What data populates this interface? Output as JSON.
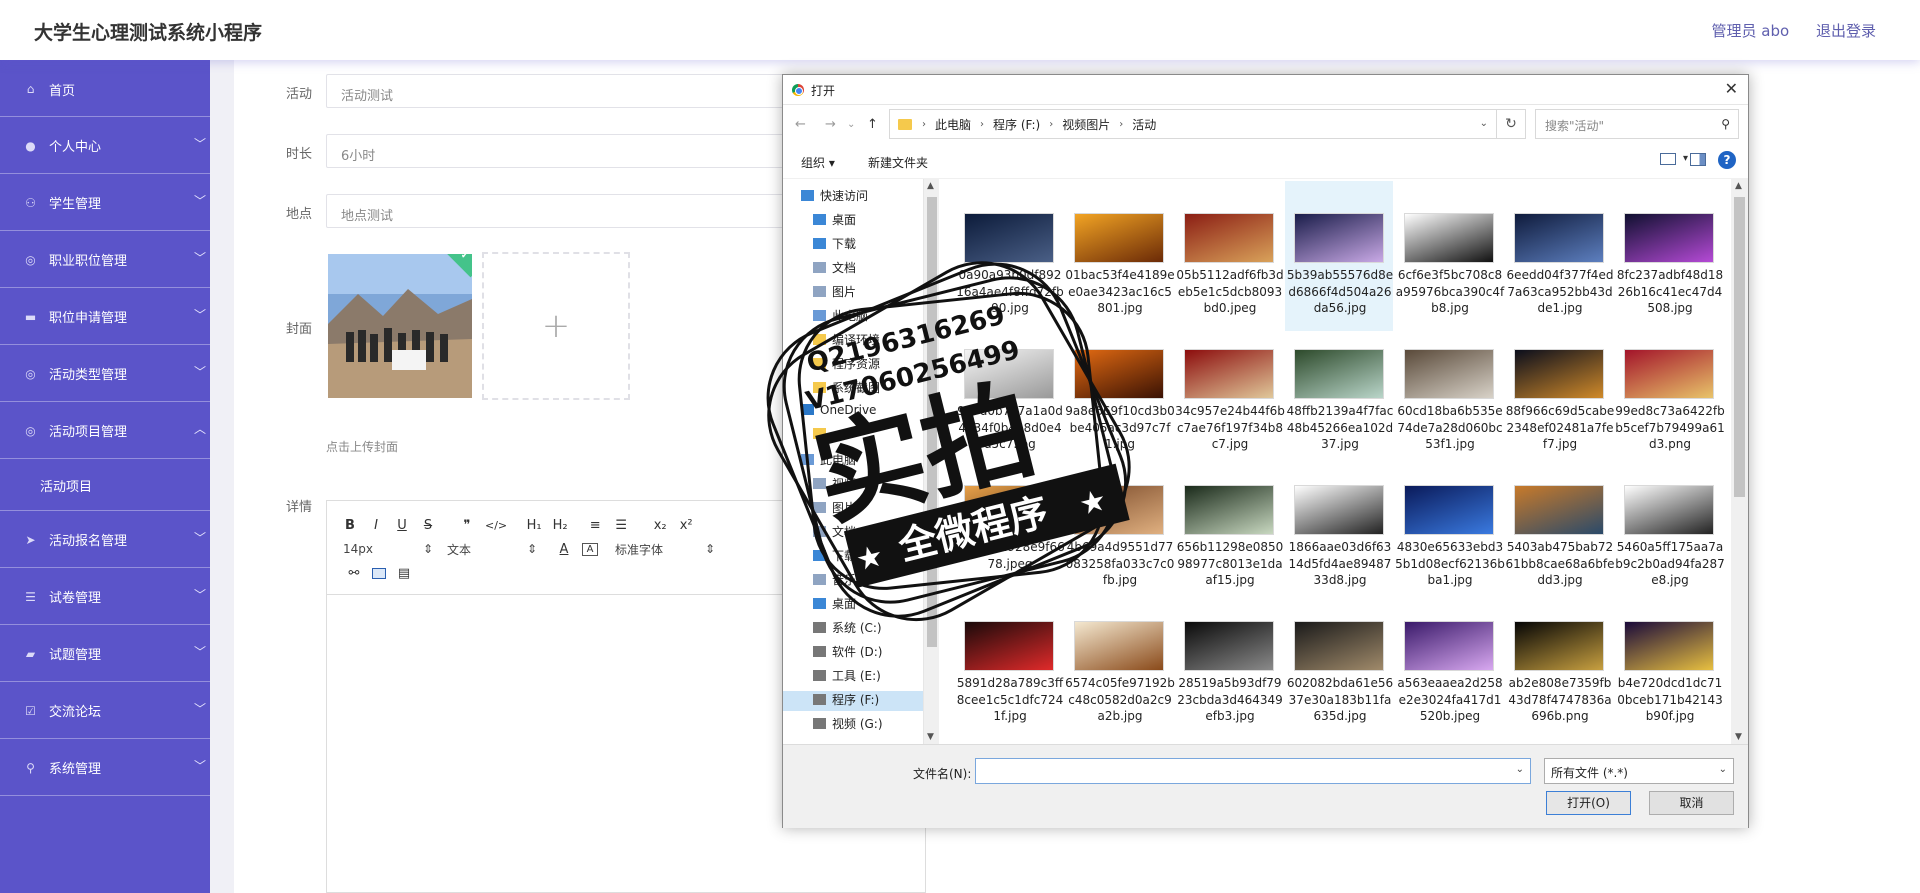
{
  "app": {
    "title": "大学生心理测试系统小程序",
    "admin_label": "管理员 abo",
    "logout_label": "退出登录"
  },
  "sidebar": {
    "items": [
      {
        "label": "首页",
        "icon": "home-icon",
        "glyph": "⌂"
      },
      {
        "label": "个人中心",
        "icon": "user-icon",
        "glyph": "●"
      },
      {
        "label": "学生管理",
        "icon": "student-icon",
        "glyph": "⚇"
      },
      {
        "label": "职业职位管理",
        "icon": "position-icon",
        "glyph": "◎"
      },
      {
        "label": "职位申请管理",
        "icon": "monitor-icon",
        "glyph": "▬"
      },
      {
        "label": "活动类型管理",
        "icon": "compass-icon",
        "glyph": "◎"
      },
      {
        "label": "活动项目管理",
        "icon": "compass-icon",
        "glyph": "◎"
      },
      {
        "label": "活动报名管理",
        "icon": "send-icon",
        "glyph": "➤"
      },
      {
        "label": "试卷管理",
        "icon": "list-icon",
        "glyph": "☰"
      },
      {
        "label": "试题管理",
        "icon": "cart-icon",
        "glyph": "▰"
      },
      {
        "label": "交流论坛",
        "icon": "check-icon",
        "glyph": "☑"
      },
      {
        "label": "系统管理",
        "icon": "mic-icon",
        "glyph": "⚲"
      }
    ],
    "sub_item": "活动项目"
  },
  "form": {
    "activity_label": "活动",
    "activity_value": "活动测试",
    "duration_label": "时长",
    "duration_value": "6小时",
    "location_label": "地点",
    "location_value": "地点测试",
    "cover_label": "封面",
    "upload_hint": "点击上传封面",
    "detail_label": "详情",
    "editor": {
      "font_size": "14px",
      "text_type": "文本",
      "font_family": "标准字体",
      "toolbar_row1": [
        "B",
        "I",
        "U",
        "S",
        "❞",
        "</>",
        "H₁",
        "H₂",
        "≡",
        "☰",
        "x₂",
        "x²"
      ]
    }
  },
  "dialog": {
    "title": "打开",
    "breadcrumbs": [
      "此电脑",
      "程序 (F:)",
      "视频图片",
      "活动"
    ],
    "search_placeholder": "搜索\"活动\"",
    "organize": "组织 ▾",
    "new_folder": "新建文件夹",
    "tree": [
      {
        "label": "快速访问",
        "indent": 0,
        "color": "#3b87d6"
      },
      {
        "label": "桌面",
        "indent": 1,
        "color": "#3b87d6"
      },
      {
        "label": "下载",
        "indent": 1,
        "color": "#3b87d6"
      },
      {
        "label": "文档",
        "indent": 1,
        "color": "#8fa4c2"
      },
      {
        "label": "图片",
        "indent": 1,
        "color": "#8fa4c2"
      },
      {
        "label": "此电脑",
        "indent": 1,
        "color": "#6a9ad6"
      },
      {
        "label": "编译环境",
        "indent": 1,
        "color": "#f5c94c"
      },
      {
        "label": "程序资源",
        "indent": 1,
        "color": "#f5c94c"
      },
      {
        "label": "系统截图",
        "indent": 1,
        "color": "#f5c94c"
      },
      {
        "label": "OneDrive",
        "indent": 0,
        "color": "#2b78c8"
      },
      {
        "label": "",
        "indent": 1,
        "color": "#f5c94c"
      },
      {
        "label": "此电脑",
        "indent": 0,
        "color": "#6a9ad6"
      },
      {
        "label": "视频",
        "indent": 1,
        "color": "#8fa4c2"
      },
      {
        "label": "图片",
        "indent": 1,
        "color": "#8fa4c2"
      },
      {
        "label": "文档",
        "indent": 1,
        "color": "#8fa4c2"
      },
      {
        "label": "下载",
        "indent": 1,
        "color": "#3b87d6"
      },
      {
        "label": "音乐",
        "indent": 1,
        "color": "#8fa4c2"
      },
      {
        "label": "桌面",
        "indent": 1,
        "color": "#3b87d6"
      },
      {
        "label": "系统 (C:)",
        "indent": 1,
        "color": "#777"
      },
      {
        "label": "软件 (D:)",
        "indent": 1,
        "color": "#777"
      },
      {
        "label": "工具 (E:)",
        "indent": 1,
        "color": "#777"
      },
      {
        "label": "程序 (F:)",
        "indent": 1,
        "color": "#777",
        "selected": true
      },
      {
        "label": "视频 (G:)",
        "indent": 1,
        "color": "#777"
      }
    ],
    "files": [
      {
        "name": "0a90a93b0df89216a4ae4f8ffd72fb90.jpg",
        "c1": "#0c1b3a",
        "c2": "#4a5f86"
      },
      {
        "name": "01bac53f4e4189ee0ae3423ac16c5801.jpg",
        "c1": "#f2a424",
        "c2": "#6b2a07"
      },
      {
        "name": "05b5112adf6fb3deb5e1c5dcb8093bd0.jpeg",
        "c1": "#8b1e14",
        "c2": "#d9a25a"
      },
      {
        "name": "5b39ab55576d8ed6866f4d504a26da56.jpg",
        "c1": "#1a1d4a",
        "c2": "#c9a9e6",
        "selected": true
      },
      {
        "name": "6cf6e3f5bc708c8a95976bca390c4fb8.jpg",
        "c1": "#ffffff",
        "c2": "#111111"
      },
      {
        "name": "6eedd04f377f4ed7a63ca952bb43dde1.jpg",
        "c1": "#0f1b3c",
        "c2": "#5d7fbf"
      },
      {
        "name": "8fc237adbf48d1826b16c41ec47d4508.jpg",
        "c1": "#101030",
        "c2": "#b54ad6"
      },
      {
        "name": "9e7d0b7e7a1a0d4734f0b4b8d0e4a5c7.jpg",
        "c1": "#f4f4f4",
        "c2": "#999999"
      },
      {
        "name": "9a8e669f10cd3b0be405ac3d97c7f1.jpg",
        "c1": "#e26a12",
        "c2": "#3a1204"
      },
      {
        "name": "34c957e24b44f6bc7ae76f197f34b8c7.jpg",
        "c1": "#8c0d0d",
        "c2": "#e0c89a"
      },
      {
        "name": "48ffb2139a4f7fac48b45266ea102d37.jpg",
        "c1": "#2d4a2b",
        "c2": "#b9d5c9"
      },
      {
        "name": "60cd18ba6b535e74de7a28d060bc53f1.jpg",
        "c1": "#5a4a3a",
        "c2": "#d8d2c8"
      },
      {
        "name": "88f966c69d5cabe2348ef02481a7fef7.jpg",
        "c1": "#0b0e1c",
        "c2": "#d08a2a"
      },
      {
        "name": "99ed8c73a6422fbb5cef7b79499a61d3.png",
        "c1": "#a3142a",
        "c2": "#e8c46a"
      },
      {
        "name": "0e6c7b1928e9f6678.jpeg",
        "c1": "#e8a14a",
        "c2": "#4a2a10"
      },
      {
        "name": "4b69a4d9551d77083258fa033c7c0fb.jpg",
        "c1": "#7a4a2a",
        "c2": "#e0b080"
      },
      {
        "name": "656b11298e085098977c8013e1daaf15.jpg",
        "c1": "#1a2a1a",
        "c2": "#c8d8c0"
      },
      {
        "name": "1866aae03d6f6314d5fd4ae8948733d8.jpg",
        "c1": "#ffffff",
        "c2": "#222222"
      },
      {
        "name": "4830e65633ebd35b1d08ecf62136bba1.jpg",
        "c1": "#0a1a5a",
        "c2": "#3a7ae0"
      },
      {
        "name": "5403ab475bab7261bb8cae68a6bfedd3.jpg",
        "c1": "#c87a2a",
        "c2": "#2a4a6a"
      },
      {
        "name": "5460a5ff175aa7ab9c2b0ad94fa287e8.jpg",
        "c1": "#ffffff",
        "c2": "#222222"
      },
      {
        "name": "5891d28a789c3ff8cee1c5c1dfc7241f.jpg",
        "c1": "#1a0a0a",
        "c2": "#e02a2a"
      },
      {
        "name": "6574c05fe97192bc48c0582d0a2c9a2b.jpg",
        "c1": "#f4e8d0",
        "c2": "#8a4a1a"
      },
      {
        "name": "28519a5b93df7923cbda3d464349efb3.jpg",
        "c1": "#0a0a0a",
        "c2": "#8a8a8a"
      },
      {
        "name": "602082bda61e5637e30a183b11fa635d.jpg",
        "c1": "#1a1a1a",
        "c2": "#a08a6a"
      },
      {
        "name": "a563eaaea2d258e2e3024fa417d1520b.jpeg",
        "c1": "#3a1a6a",
        "c2": "#d8a8f0"
      },
      {
        "name": "ab2e808e7359fb43d78f4747836a696b.png",
        "c1": "#050505",
        "c2": "#c8a040"
      },
      {
        "name": "b4e720dcd1dc710bceb171b42143b90f.jpg",
        "c1": "#1a0a3a",
        "c2": "#e8c040"
      }
    ],
    "filename_label": "文件名(N):",
    "filetype": "所有文件 (*.*)",
    "open_label": "打开(O)",
    "cancel_label": "取消"
  },
  "watermark": {
    "line1": "Q2196316269",
    "line2": "V17060256499",
    "big": "实拍",
    "banner": "全微程序"
  }
}
